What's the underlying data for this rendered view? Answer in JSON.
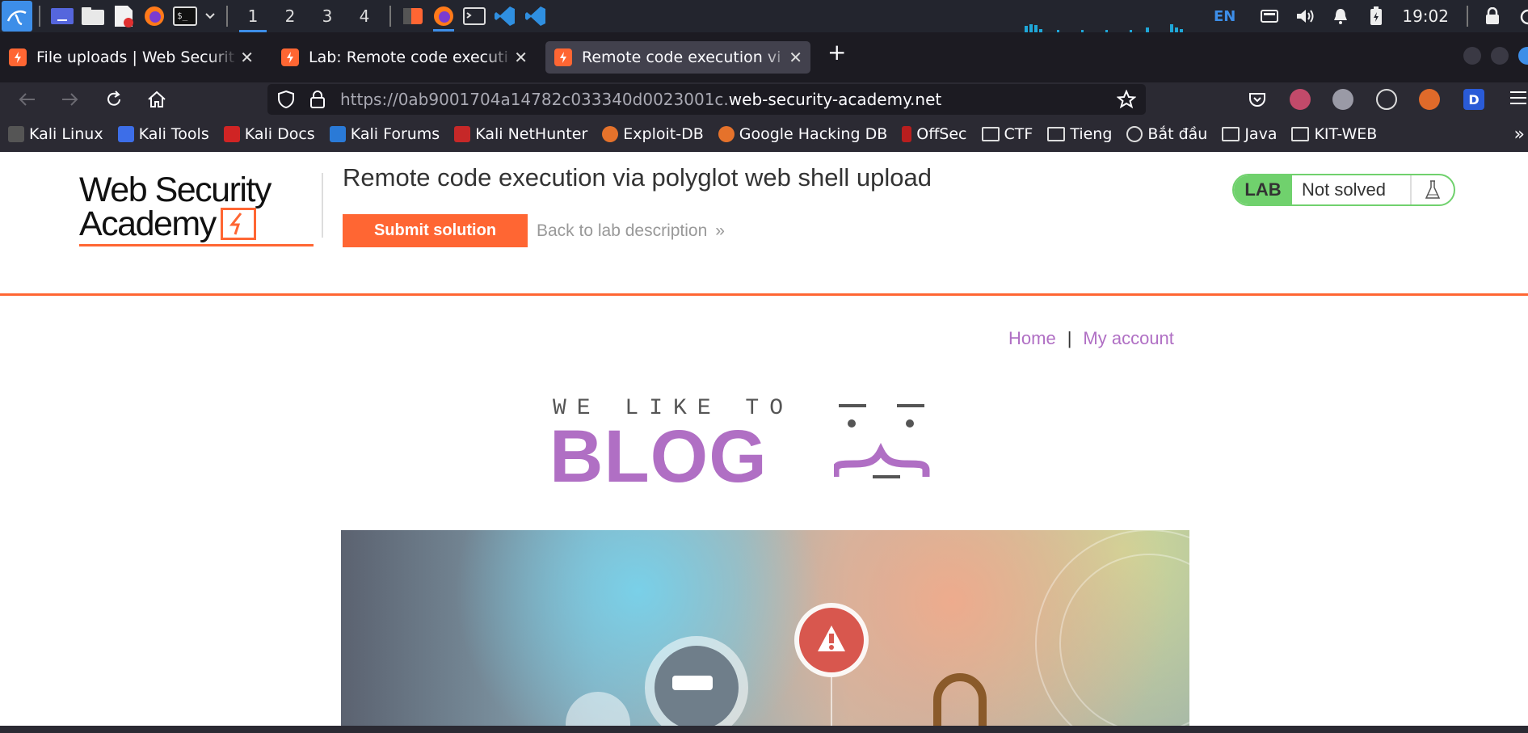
{
  "taskbar": {
    "workspaces": [
      "1",
      "2",
      "3",
      "4"
    ],
    "language": "EN",
    "clock": "19:02",
    "icons": [
      "kali-menu-icon",
      "desktop-icon",
      "files-icon",
      "text-editor-icon",
      "firefox-icon",
      "terminal-icon",
      "burp-icon",
      "vscode-icon"
    ]
  },
  "tabs": [
    {
      "title": "File uploads | Web Securit"
    },
    {
      "title": "Lab: Remote code executi"
    },
    {
      "title": "Remote code execution vi"
    }
  ],
  "url": {
    "prefix": "https://0ab9001704a14782c033340d0023001c.",
    "domain": "web-security-academy.net"
  },
  "bookmarks": [
    {
      "label": "Kali Linux",
      "type": "site"
    },
    {
      "label": "Kali Tools",
      "type": "site"
    },
    {
      "label": "Kali Docs",
      "type": "site"
    },
    {
      "label": "Kali Forums",
      "type": "site"
    },
    {
      "label": "Kali NetHunter",
      "type": "site"
    },
    {
      "label": "Exploit-DB",
      "type": "site"
    },
    {
      "label": "Google Hacking DB",
      "type": "site"
    },
    {
      "label": "OffSec",
      "type": "site"
    },
    {
      "label": "CTF",
      "type": "folder"
    },
    {
      "label": "Tieng",
      "type": "folder"
    },
    {
      "label": "Bắt đầu",
      "type": "globe"
    },
    {
      "label": "Java",
      "type": "folder"
    },
    {
      "label": "KIT-WEB",
      "type": "folder"
    }
  ],
  "academy": {
    "logo_line1": "Web Security",
    "logo_line2": "Academy",
    "lab_title": "Remote code execution via polyglot web shell upload",
    "submit_label": "Submit solution",
    "back_label": "Back to lab description",
    "lab_badge": "LAB",
    "lab_status": "Not solved"
  },
  "blog": {
    "nav_home": "Home",
    "nav_separator": "|",
    "nav_account": "My account",
    "banner_top": "WE LIKE TO",
    "banner_main": "BLOG"
  },
  "colors": {
    "brand_orange": "#ff6633",
    "lab_green": "#70d16d",
    "blog_purple": "#b06fc4",
    "accent_blue": "#3d8ee8"
  }
}
